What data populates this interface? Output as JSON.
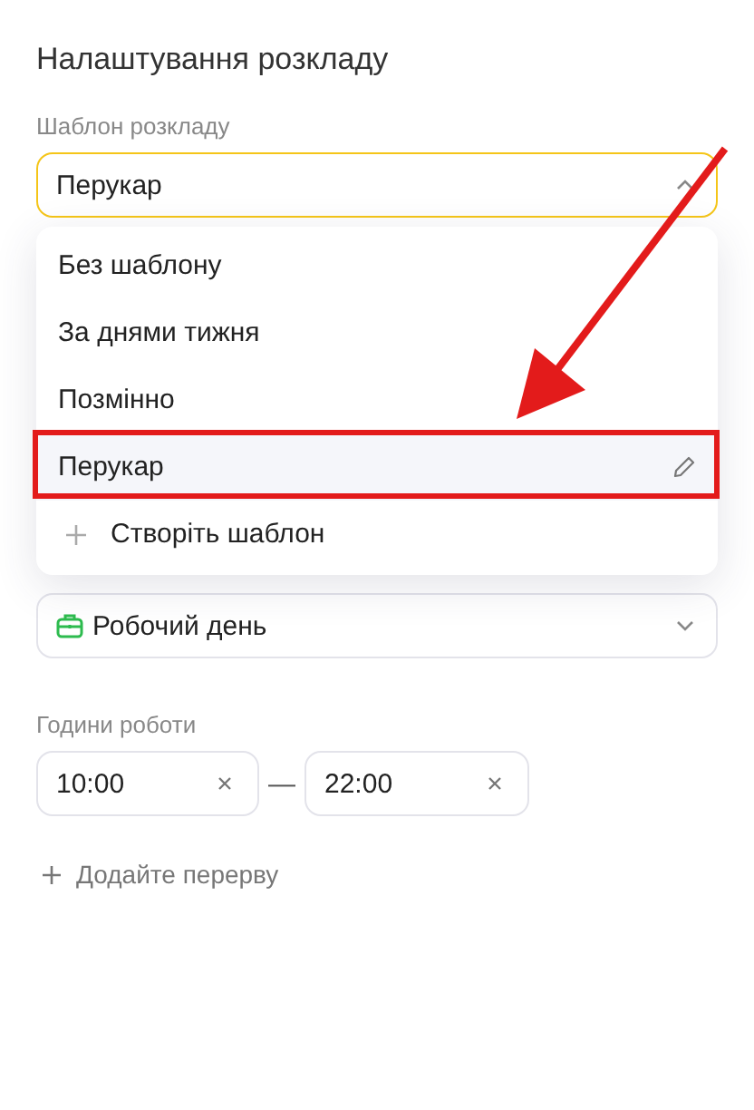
{
  "title": "Налаштування розкладу",
  "template_field": {
    "label": "Шаблон розкладу",
    "value": "Перукар",
    "expanded": true,
    "options": [
      {
        "kind": "option",
        "label": "Без шаблону",
        "selected": false,
        "editable": false
      },
      {
        "kind": "option",
        "label": "За днями тижня",
        "selected": false,
        "editable": false
      },
      {
        "kind": "option",
        "label": "Позмінно",
        "selected": false,
        "editable": false
      },
      {
        "kind": "option",
        "label": "Перукар",
        "selected": true,
        "editable": true
      },
      {
        "kind": "create",
        "label": "Створіть шаблон",
        "selected": false,
        "editable": false
      }
    ]
  },
  "schedule_type_field": {
    "value": "Робочий день",
    "expanded": false
  },
  "hours": {
    "label": "Години роботи",
    "from": "10:00",
    "to": "22:00",
    "separator": "—"
  },
  "add_break": "Додайте перерву"
}
